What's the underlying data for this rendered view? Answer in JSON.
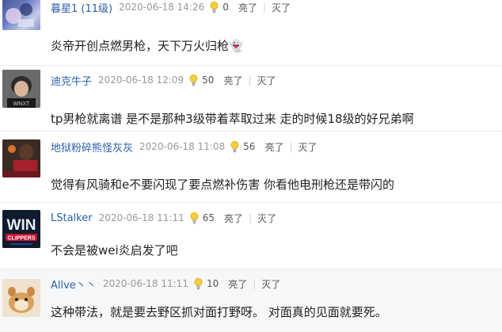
{
  "comments": [
    {
      "username": "暮星1 (11级)",
      "date": "2020-06-18 14:26",
      "likes": "0",
      "like_label": "亮了",
      "dislike_label": "灭了",
      "text": "炎帝开创点燃男枪，天下万火归枪👻"
    },
    {
      "username": "迪克牛子",
      "date": "2020-06-18 12:09",
      "likes": "50",
      "like_label": "亮了",
      "dislike_label": "灭了",
      "text": "tp男枪就离谱 是不是那种3级带着萃取过来 走的时候18级的好兄弟啊"
    },
    {
      "username": "地狱粉碎熊怪灰灰",
      "date": "2020-06-18 11:08",
      "likes": "56",
      "like_label": "亮了",
      "dislike_label": "灭了",
      "text": "觉得有风骑和e不要闪现了要点燃补伤害 你看他电刑枪还是带闪的"
    },
    {
      "username": "LStalker",
      "date": "2020-06-18 11:11",
      "likes": "65",
      "like_label": "亮了",
      "dislike_label": "灭了",
      "text": "不会是被wei炎启发了吧",
      "avatar_text_top": "WIN",
      "avatar_text_bottom": "CLIPPERS"
    },
    {
      "username": "Allve丶丶",
      "date": "2020-06-18 11:11",
      "likes": "10",
      "like_label": "亮了",
      "dislike_label": "灭了",
      "text": "这种带法，就是要去野区抓对面打野呀。 对面真的见面就要死。"
    }
  ],
  "colors": {
    "username": "#2b5fa8",
    "date": "#999999",
    "text": "#222222",
    "bulb": "#f2c230"
  }
}
